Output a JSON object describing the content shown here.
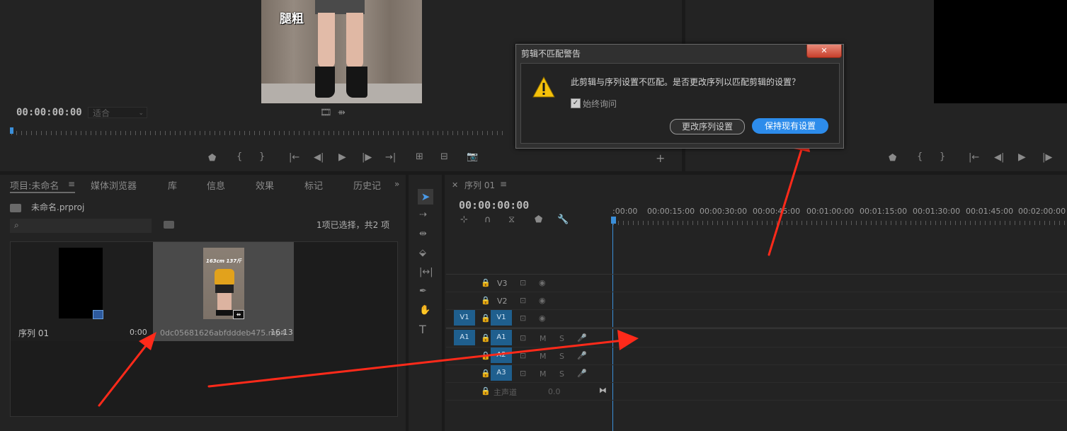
{
  "source_monitor": {
    "timecode": "00:00:00:00",
    "fit_select": "适合",
    "overlay_text": "腿粗"
  },
  "project_panel": {
    "tabs": [
      "项目:未命名",
      "媒体浏览器",
      "库",
      "信息",
      "效果",
      "标记",
      "历史记"
    ],
    "project_file": "未命名.prproj",
    "search_placeholder": "",
    "selection_status": "1项已选择，共2 项",
    "items": [
      {
        "name": "序列 01",
        "duration": "0:00"
      },
      {
        "name": "0dc05681626abfdddeb475.mp4",
        "duration": "16:13",
        "thumb_text": "163cm 137斤"
      }
    ]
  },
  "timeline": {
    "tab": "序列 01",
    "timecode": "00:00:00:00",
    "ruler_labels": [
      ":00:00",
      "00:00:15:00",
      "00:00:30:00",
      "00:00:45:00",
      "00:01:00:00",
      "00:01:15:00",
      "00:01:30:00",
      "00:01:45:00",
      "00:02:00:00"
    ],
    "video_tracks": [
      "V3",
      "V2",
      "V1"
    ],
    "audio_tracks": [
      "A1",
      "A2",
      "A3"
    ],
    "source_v": "V1",
    "source_a": "A1",
    "track_m": "M",
    "track_s": "S",
    "master": {
      "label": "主声道",
      "value": "0.0"
    }
  },
  "dialog": {
    "title": "剪辑不匹配警告",
    "message": "此剪辑与序列设置不匹配。是否更改序列以匹配剪辑的设置？",
    "checkbox_label": "始终询问",
    "checkbox_checked": true,
    "change_button": "更改序列设置",
    "keep_button": "保持现有设置",
    "close_glyph": "✕"
  },
  "colors": {
    "accent_blue": "#2d8ceb",
    "track_blue": "#1f5f8e",
    "arrow_red": "#ff2a1a",
    "playhead": "#3b8fd9"
  }
}
